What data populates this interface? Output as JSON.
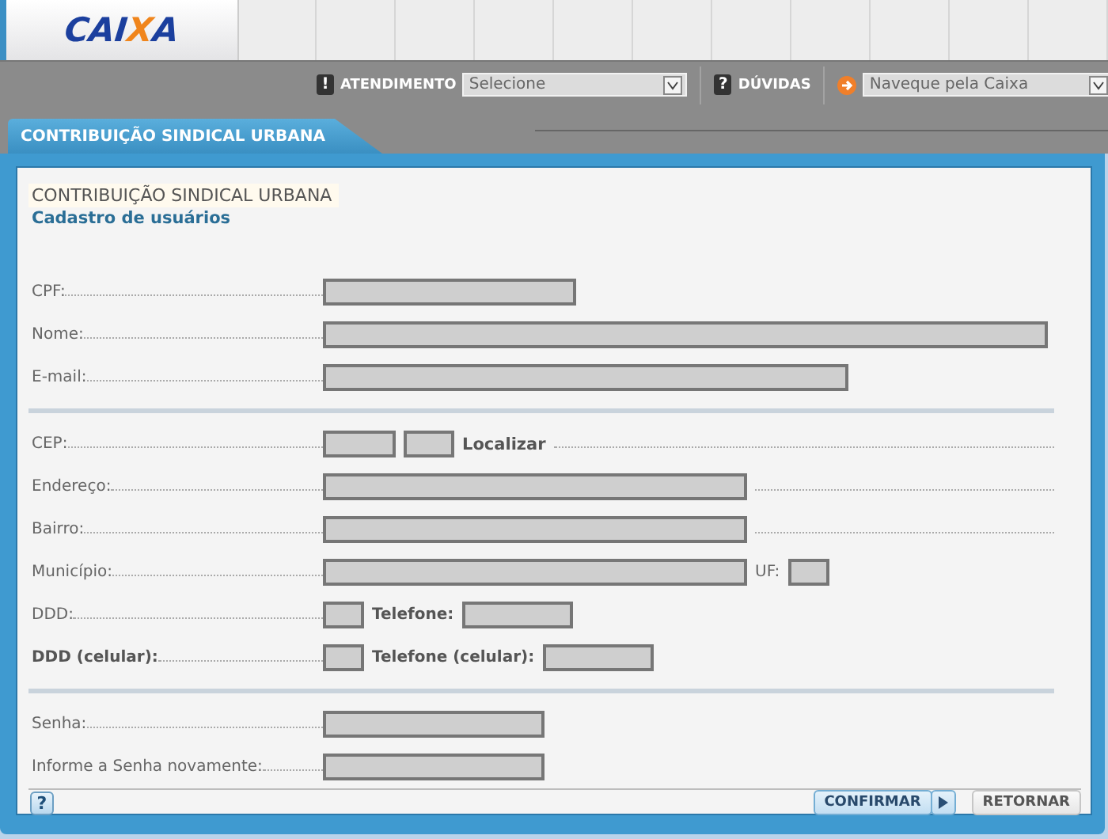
{
  "logo": [
    {
      "text": "CAI",
      "color": "#1b3f9e"
    },
    {
      "text": "X",
      "color": "#f0851c"
    },
    {
      "text": "A",
      "color": "#1b3f9e"
    }
  ],
  "nav": [
    {
      "kind": "select",
      "icon": "!",
      "label": "ATENDIMENTO",
      "value": "Selecione"
    },
    {
      "kind": "select",
      "icon": "?",
      "label": "DÚVIDAS"
    },
    {
      "kind": "arrow-select",
      "value": "Naveque pela Caixa"
    }
  ],
  "tabs": [
    {
      "label": "CONTRIBUIÇÃO SINDICAL URBANA",
      "selected": true
    }
  ],
  "panel": {
    "title": "CONTRIBUIÇÃO SINDICAL URBANA",
    "subtitle": "Cadastro de usuários",
    "sections": [
      {
        "rows": [
          {
            "label": "CPF:",
            "bold": false,
            "items": [
              {
                "kind": "field"
              }
            ]
          },
          {
            "label": "Nome:",
            "bold": false,
            "items": [
              {
                "kind": "field"
              }
            ]
          },
          {
            "label": "E-mail:",
            "bold": false,
            "items": [
              {
                "kind": "field"
              }
            ]
          }
        ]
      },
      {
        "rows": [
          {
            "label": "CEP:",
            "bold": false,
            "items": [
              {
                "kind": "field"
              },
              {
                "kind": "field"
              },
              {
                "kind": "link",
                "text": "Localizar"
              }
            ]
          },
          {
            "label": "Endereço:",
            "bold": false,
            "items": [
              {
                "kind": "field"
              }
            ]
          },
          {
            "label": "Bairro:",
            "bold": false,
            "items": [
              {
                "kind": "field"
              }
            ]
          },
          {
            "label": "Município:",
            "bold": false,
            "items": [
              {
                "kind": "field"
              },
              {
                "kind": "text",
                "text": "UF:",
                "bold": false
              },
              {
                "kind": "field"
              }
            ]
          },
          {
            "label": "DDD:",
            "bold": false,
            "items": [
              {
                "kind": "field"
              },
              {
                "kind": "text",
                "text": "Telefone:",
                "bold": true
              },
              {
                "kind": "field"
              }
            ]
          },
          {
            "label": "DDD (celular):",
            "bold": true,
            "items": [
              {
                "kind": "field"
              },
              {
                "kind": "text",
                "text": "Telefone (celular):",
                "bold": true
              },
              {
                "kind": "field"
              }
            ]
          }
        ]
      },
      {
        "rows": [
          {
            "label": "Senha:",
            "bold": false,
            "items": [
              {
                "kind": "field"
              }
            ]
          },
          {
            "label": "Informe a Senha novamente:",
            "bold": false,
            "items": [
              {
                "kind": "field"
              }
            ]
          }
        ]
      }
    ]
  },
  "footer": {
    "help": "?",
    "buttons": [
      {
        "kind": "primary",
        "label": "CONFIRMAR"
      },
      {
        "kind": "secondary",
        "label": "RETORNAR"
      }
    ]
  }
}
